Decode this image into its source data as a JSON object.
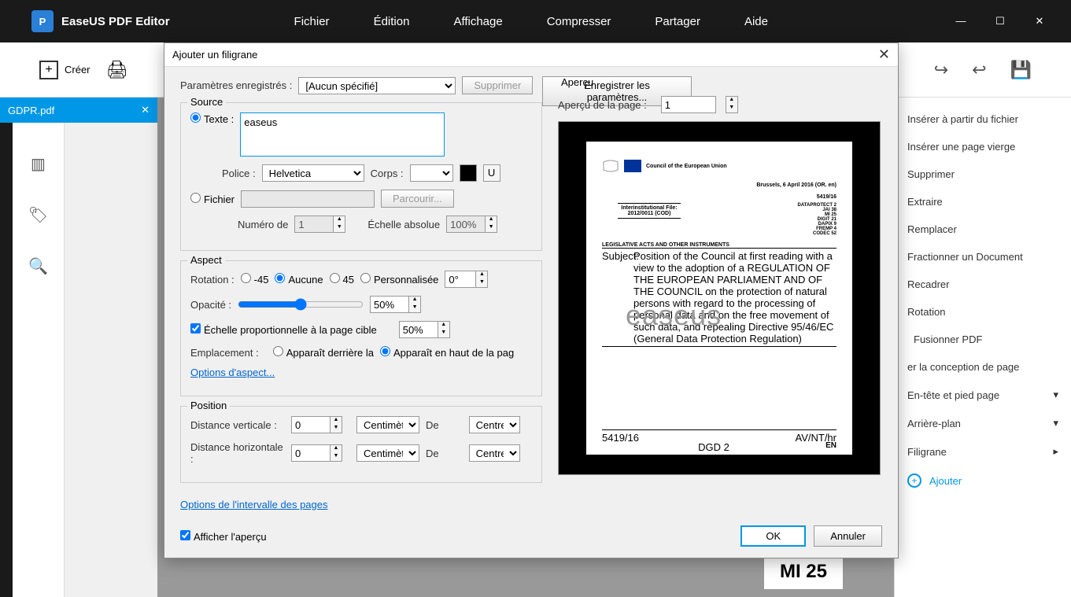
{
  "app": {
    "title": "EaseUS PDF Editor"
  },
  "menu": {
    "file": "Fichier",
    "edit": "Édition",
    "view": "Affichage",
    "compress": "Compresser",
    "share": "Partager",
    "help": "Aide"
  },
  "toolbar": {
    "create": "Créer"
  },
  "tab": {
    "filename": "GDPR.pdf"
  },
  "sidebar": {
    "items": [
      "Insérer à partir du fichier",
      "Insérer une page vierge",
      "Supprimer",
      "Extraire",
      "Remplacer",
      "Fractionner un Document",
      "Recadrer",
      "Rotation",
      "Fusionner PDF",
      "er la conception de page",
      "En-tête et pied page",
      "Arrière-plan",
      "Filigrane"
    ],
    "add": "Ajouter"
  },
  "dialog": {
    "title": "Ajouter un filigrane",
    "saved_label": "Paramètres enregistrés :",
    "saved_value": "[Aucun spécifié]",
    "delete": "Supprimer",
    "save_params": "Enregistrer les paramètres...",
    "source": {
      "legend": "Source",
      "text_label": "Texte :",
      "text_value": "easeus",
      "font_label": "Police :",
      "font_value": "Helvetica",
      "size_label": "Corps :",
      "u": "U",
      "file_label": "Fichier",
      "browse": "Parcourir...",
      "page_num_label": "Numéro de",
      "page_num_value": "1",
      "abs_scale_label": "Échelle absolue",
      "abs_scale_value": "100%"
    },
    "aspect": {
      "legend": "Aspect",
      "rotation_label": "Rotation :",
      "rot_m45": "-45",
      "rot_none": "Aucune",
      "rot_45": "45",
      "rot_custom": "Personnalisée",
      "rot_value": "0°",
      "opacity_label": "Opacité :",
      "opacity_value": "50%",
      "scale_check": "Échelle proportionnelle à la page cible",
      "scale_value": "50%",
      "placement_label": "Emplacement :",
      "behind": "Apparaît derrière la",
      "top": "Apparaît en haut de la pag",
      "options_link": "Options d'aspect..."
    },
    "position": {
      "legend": "Position",
      "vdist_label": "Distance verticale :",
      "vdist_value": "0",
      "hdist_label": "Distance horizontale :",
      "hdist_value": "0",
      "unit": "Centimètres",
      "from": "De",
      "center": "Centre"
    },
    "page_range_link": "Options de l'intervalle des pages",
    "preview": {
      "legend": "Aperçu",
      "page_label": "Aperçu de la page :",
      "page_value": "1"
    },
    "show_preview": "Afficher l'aperçu",
    "ok": "OK",
    "cancel": "Annuler"
  },
  "doc_preview": {
    "council": "Council of the European Union",
    "location": "Brussels, 6 April 2016 (OR. en)",
    "ref": "5419/16",
    "file": "Interinstitutional File: 2012/0011 (COD)",
    "codes": "DATAPROTECT 2\nJAI 38\nMI 25\nDIGIT 21\nDAPIX 9\nFREMP 4\nCODEC 52",
    "acts": "LEGISLATIVE ACTS AND OTHER INSTRUMENTS",
    "subject_label": "Subject:",
    "subject": "Position of the Council at first reading with a view to the adoption of a REGULATION OF THE EUROPEAN PARLIAMENT AND OF THE COUNCIL on the protection of natural persons with regard to the processing of personal data and on the free movement of such data, and repealing Directive 95/46/EC (General Data Protection Regulation)",
    "watermark": "easeus",
    "footer_left": "5419/16",
    "footer_mid": "DGD 2",
    "footer_mid2": "AV/NT/hr",
    "footer_right": "EN"
  },
  "peek": "MI 25"
}
